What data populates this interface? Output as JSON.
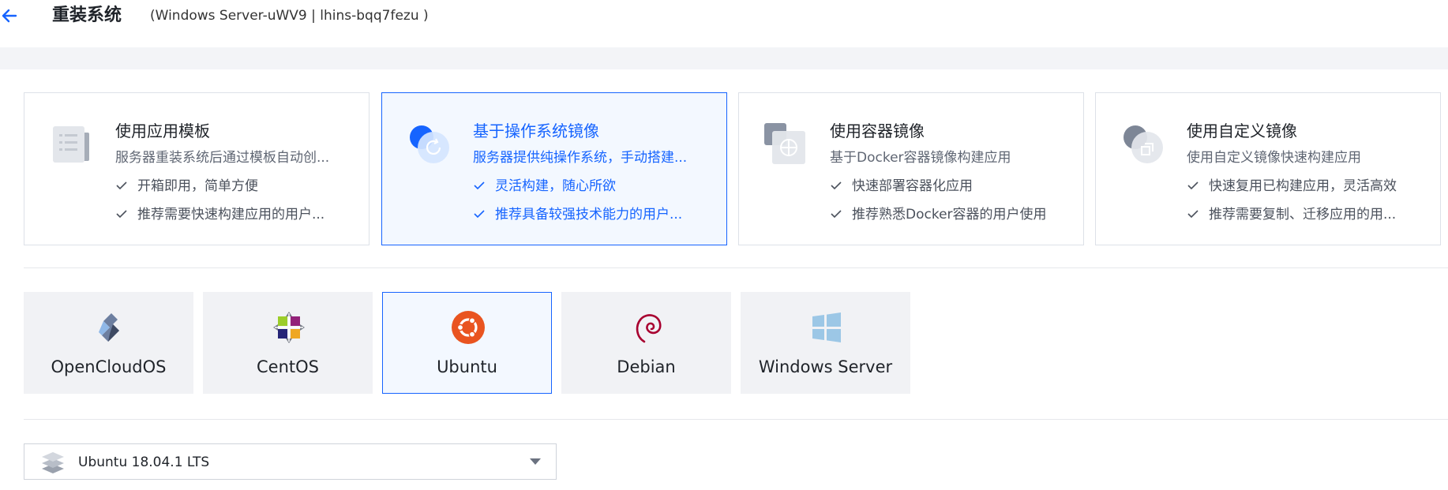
{
  "header": {
    "title": "重装系统",
    "subtitle": "(Windows Server-uWV9 | lhins-bqq7fezu )",
    "back_icon": "arrow-left-icon"
  },
  "deploy_types": [
    {
      "title": "使用应用模板",
      "desc": "服务器重装系统后通过模板自动创...",
      "features": [
        "开箱即用，简单方便",
        "推荐需要快速构建应用的用户..."
      ],
      "icon": "app-template-icon",
      "selected": false
    },
    {
      "title": "基于操作系统镜像",
      "desc": "服务器提供纯操作系统，手动搭建...",
      "features": [
        "灵活构建，随心所欲",
        "推荐具备较强技术能力的用户..."
      ],
      "icon": "os-image-icon",
      "selected": true
    },
    {
      "title": "使用容器镜像",
      "desc": "基于Docker容器镜像构建应用",
      "features": [
        "快速部署容器化应用",
        "推荐熟悉Docker容器的用户使用"
      ],
      "icon": "container-image-icon",
      "selected": false
    },
    {
      "title": "使用自定义镜像",
      "desc": "使用自定义镜像快速构建应用",
      "features": [
        "快速复用已构建应用，灵活高效",
        "推荐需要复制、迁移应用的用..."
      ],
      "icon": "custom-image-icon",
      "selected": false
    }
  ],
  "os_options": [
    {
      "name": "OpenCloudOS",
      "icon": "opencloudos-logo-icon",
      "selected": false
    },
    {
      "name": "CentOS",
      "icon": "centos-logo-icon",
      "selected": false
    },
    {
      "name": "Ubuntu",
      "icon": "ubuntu-logo-icon",
      "selected": true
    },
    {
      "name": "Debian",
      "icon": "debian-logo-icon",
      "selected": false
    },
    {
      "name": "Windows Server",
      "icon": "windows-logo-icon",
      "selected": false
    }
  ],
  "version_select": {
    "value": "Ubuntu 18.04.1 LTS",
    "icon": "layers-icon"
  },
  "colors": {
    "accent": "#1664ff",
    "ubuntu": "#e95420",
    "debian": "#a80030",
    "windows": "#9cc7e6"
  }
}
